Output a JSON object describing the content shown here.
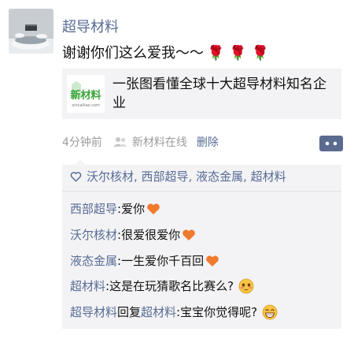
{
  "post": {
    "username": "超导材料",
    "text": "谢谢你们这么爱我～～",
    "flowers": "🌹🌹🌹",
    "link_card": {
      "thumb_logo_text": "新材料",
      "thumb_url_text": "xincailiao.com",
      "title": "一张图看懂全球十大超导材料知名企业"
    },
    "meta": {
      "time": "4分钟前",
      "source": "新材料在线",
      "delete_label": "删除"
    }
  },
  "likes": {
    "names": "沃尔核材, 西部超导, 液态金属, 超材料"
  },
  "comments": [
    {
      "name": "西部超导",
      "sep": ": ",
      "text": "爱你",
      "emoji": "heart-emoji"
    },
    {
      "name": "沃尔核材",
      "sep": ": ",
      "text": "很爱很爱你",
      "emoji": "heart-emoji"
    },
    {
      "name": "液态金属",
      "sep": ": ",
      "text": "一生爱你千百回",
      "emoji": "heart-emoji"
    },
    {
      "name": "超材料",
      "sep": ": ",
      "text": "这是在玩猜歌名比赛么?",
      "emoji": "blush-emoji"
    },
    {
      "name": "超导材料",
      "reply_word": "回复",
      "reply_to": "超材料",
      "sep": ": ",
      "text": "宝宝你觉得呢?",
      "emoji": "grin-emoji"
    }
  ],
  "colors": {
    "name_link": "#576b95",
    "meta_gray": "#9b9b9b",
    "panel_bg": "#f3f3f5",
    "more_button_bg": "#5b6a8f",
    "logo_green": "#3aa63a"
  }
}
